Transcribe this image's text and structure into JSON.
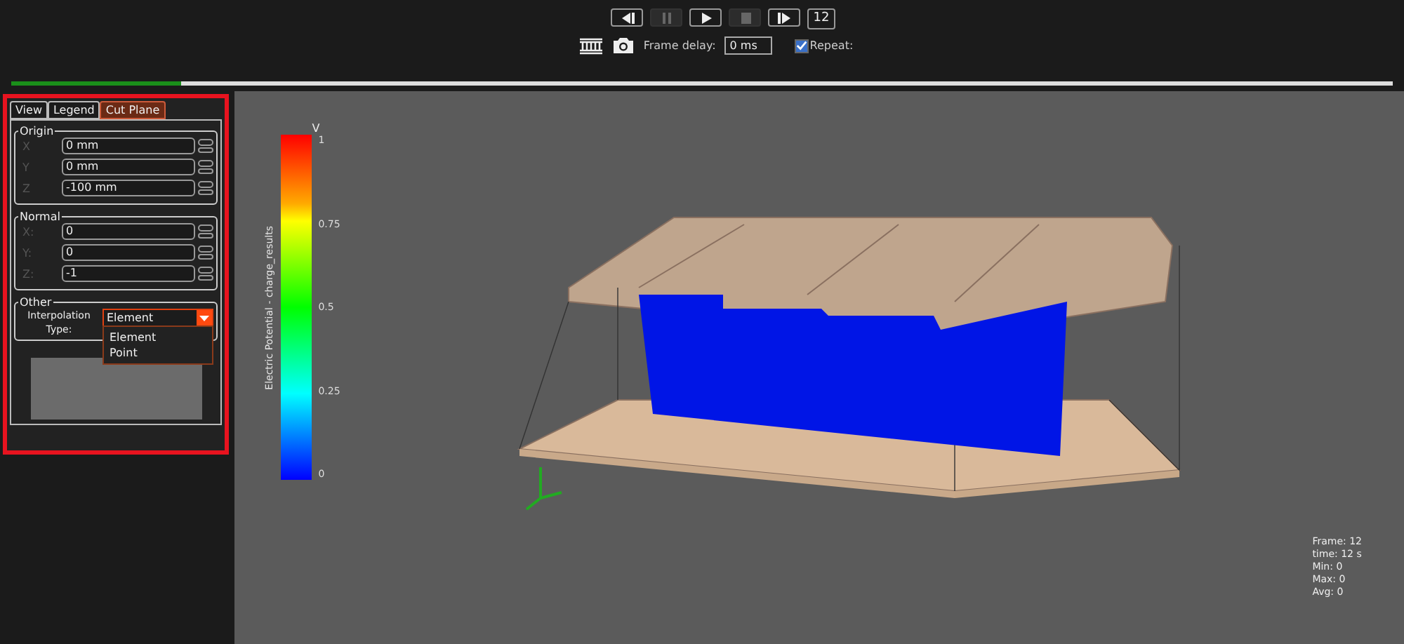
{
  "toolbar": {
    "buttons": [
      {
        "kind": "step-back",
        "disabled": false
      },
      {
        "kind": "pause",
        "disabled": true
      },
      {
        "kind": "play",
        "disabled": false
      },
      {
        "kind": "stop",
        "disabled": true
      },
      {
        "kind": "step-forward",
        "disabled": false
      }
    ],
    "frame": "12",
    "frame_delay_label": "Frame delay:",
    "frame_delay": "0 ms",
    "repeat": {
      "label": "Repeat:",
      "checked": true
    }
  },
  "timeline": {
    "level": 0.123
  },
  "tabs": [
    {
      "label": "View",
      "selected": false
    },
    {
      "label": "Legend",
      "selected": false
    },
    {
      "label": "Cut Plane",
      "selected": true
    }
  ],
  "groups": [
    {
      "title": "Origin",
      "fields": [
        {
          "label": "X",
          "value": "0 mm"
        },
        {
          "label": "Y",
          "value": "0 mm"
        },
        {
          "label": "Z",
          "value": "-100 mm"
        }
      ]
    },
    {
      "title": "Normal",
      "fields": [
        {
          "label": "X:",
          "value": "0"
        },
        {
          "label": "Y:",
          "value": "0"
        },
        {
          "label": "Z:",
          "value": "-1"
        }
      ]
    }
  ],
  "other": {
    "title": "Other",
    "label": "Interpolation Type:",
    "value": "Element",
    "expanded": true,
    "options": [
      "Element",
      "Point"
    ]
  },
  "legend": {
    "unit": "V",
    "title": "Electric Potential - charge_results",
    "ticks": [
      "1",
      "0.75",
      "0.5",
      "0.25",
      "0"
    ]
  },
  "info": [
    "Frame: 12",
    "time: 12 s",
    "Min: 0",
    "Max: 0",
    "Avg: 0"
  ]
}
